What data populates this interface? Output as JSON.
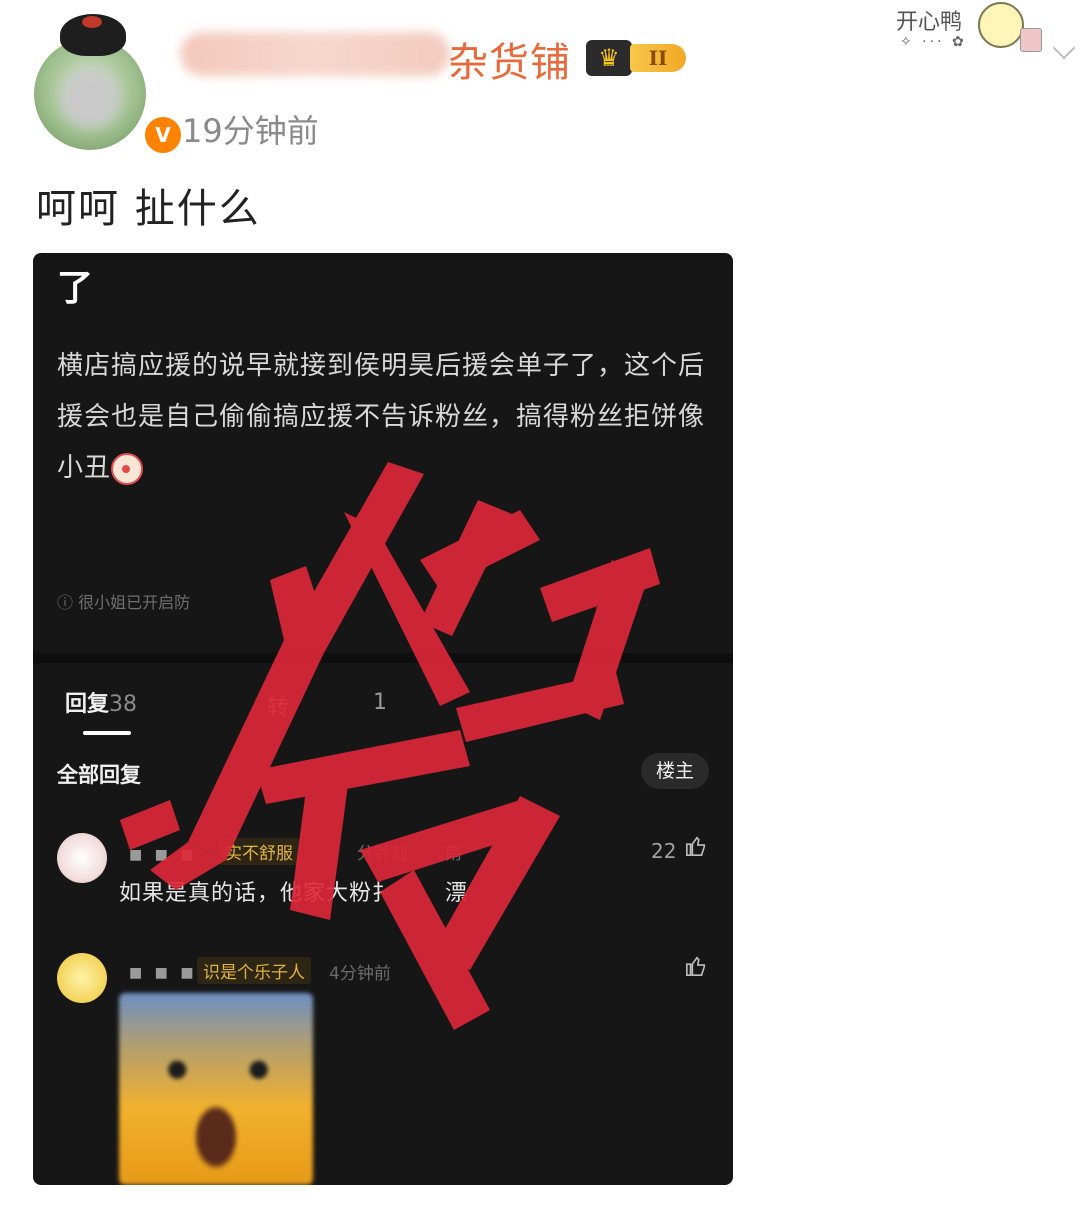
{
  "post": {
    "username_visible": "杂货铺",
    "vip_level": "II",
    "vip_crown_icon": "crown-icon",
    "verified_badge": "V",
    "timestamp": "19分钟前",
    "text": "呵呵 扯什么"
  },
  "sticker": {
    "text": "开心鸭",
    "deco": "✧ ··· ✿"
  },
  "screenshot": {
    "top_text": "了",
    "body_text": "横店搞应援的说早就接到侯明昊后援会单子了，这个后援会也是自己偷偷搞应援不告诉粉丝，搞得粉丝拒饼像小丑",
    "privacy_note": "ⓘ 很小姐已开启防",
    "tabs": {
      "replies_label": "回复",
      "replies_count": "38",
      "reposts_label": "转",
      "more_label": "1"
    },
    "all_replies_label": "全部回复",
    "op_button": "楼主",
    "comments": [
      {
        "dots": "■ ■ ■",
        "tag": "实不舒服",
        "meta": "分钟前",
        "meta2": "南",
        "text": "如果是真的话，他家大粉扌",
        "text_tail": "漂",
        "likes": "22"
      },
      {
        "dots": "■ ■ ■",
        "tag": "识是个乐子人",
        "meta": "4分钟前",
        "text": "",
        "likes": ""
      }
    ]
  },
  "stamp": {
    "character": "假",
    "color": "#e0283a"
  },
  "colors": {
    "username": "#e86a3c",
    "verify": "#ff8200",
    "timestamp": "#8a8a8a",
    "dark_bg": "#161616"
  }
}
